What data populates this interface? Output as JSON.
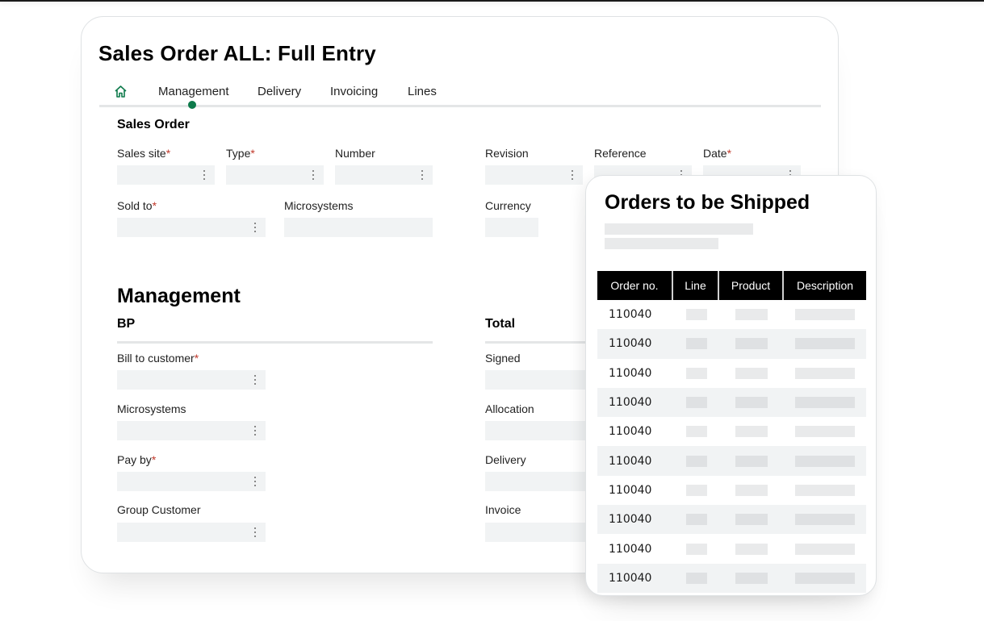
{
  "window": {
    "title": "Sales Order ALL: Full Entry"
  },
  "tabs": [
    {
      "label": "home",
      "icon": "home-icon"
    },
    {
      "label": "Management",
      "active": true
    },
    {
      "label": "Delivery"
    },
    {
      "label": "Invoicing"
    },
    {
      "label": "Lines"
    }
  ],
  "accent_color": "#0d7a4b",
  "required_color": "#c0392b",
  "sales_order": {
    "title": "Sales Order",
    "fields": [
      {
        "label": "Sales site",
        "required": "*",
        "value": ""
      },
      {
        "label": "Type",
        "required": "*",
        "value": ""
      },
      {
        "label": "Number",
        "required": "",
        "value": ""
      },
      {
        "label": "Revision",
        "required": "",
        "value": ""
      },
      {
        "label": "Reference",
        "required": "",
        "value": ""
      },
      {
        "label": "Date",
        "required": "*",
        "value": ""
      },
      {
        "label": "Sold to",
        "required": "*",
        "value": ""
      },
      {
        "label": "Microsystems",
        "required": "",
        "value": ""
      },
      {
        "label": "Currency",
        "required": "",
        "value": ""
      }
    ]
  },
  "management": {
    "title": "Management",
    "bp": {
      "title": "BP",
      "fields": [
        {
          "label": "Bill to customer",
          "required": "*",
          "value": ""
        },
        {
          "label": "Microsystems",
          "required": "",
          "value": ""
        },
        {
          "label": "Pay by",
          "required": "*",
          "value": ""
        },
        {
          "label": "Group Customer",
          "required": "",
          "value": ""
        }
      ]
    },
    "total": {
      "title": "Total",
      "fields": [
        {
          "label": "Signed",
          "value": ""
        },
        {
          "label": "Allocation",
          "value": ""
        },
        {
          "label": "Delivery",
          "value": ""
        },
        {
          "label": "Invoice",
          "value": ""
        }
      ]
    }
  },
  "orders_panel": {
    "title": "Orders to be Shipped",
    "columns": [
      "Order no.",
      "Line",
      "Product",
      "Description"
    ],
    "rows": [
      {
        "order_no": "110040"
      },
      {
        "order_no": "110040"
      },
      {
        "order_no": "110040"
      },
      {
        "order_no": "110040"
      },
      {
        "order_no": "110040"
      },
      {
        "order_no": "110040"
      },
      {
        "order_no": "110040"
      },
      {
        "order_no": "110040"
      },
      {
        "order_no": "110040"
      },
      {
        "order_no": "110040"
      }
    ]
  }
}
